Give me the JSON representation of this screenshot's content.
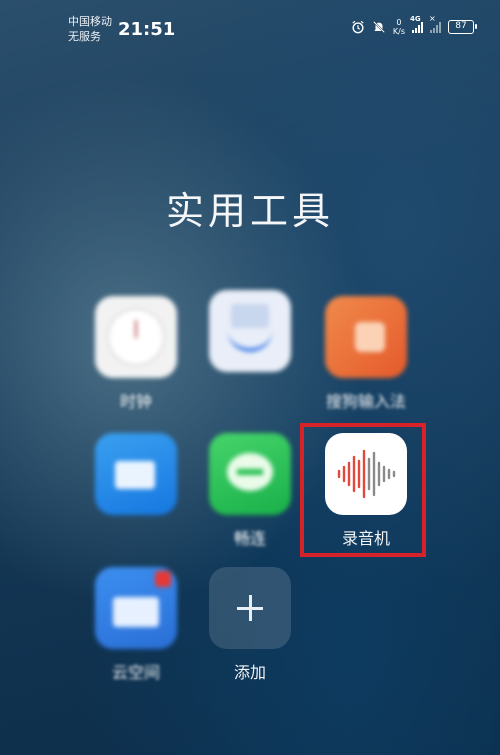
{
  "status_bar": {
    "carrier_line1": "中国移动",
    "carrier_line2": "无服务",
    "time": "21:51",
    "speed_value": "0",
    "speed_unit": "K/s",
    "network": "4G",
    "battery": "87"
  },
  "folder": {
    "title": "实用工具"
  },
  "apps": [
    {
      "label": "时钟",
      "icon": "clock-icon"
    },
    {
      "label": "",
      "icon": "cloud-icon"
    },
    {
      "label": "搜狗输入法",
      "icon": "orange-app-icon"
    },
    {
      "label": "",
      "icon": "blue-app-icon"
    },
    {
      "label": "畅连",
      "icon": "chat-icon"
    },
    {
      "label": "录音机",
      "icon": "sound-recorder-icon"
    },
    {
      "label": "云空间",
      "icon": "files-icon"
    },
    {
      "label": "添加",
      "icon": "add-icon"
    }
  ],
  "colors": {
    "highlight_border": "#d6232a",
    "recorder_wave_red": "#e2493e",
    "recorder_wave_gray": "#8a8a8a"
  }
}
